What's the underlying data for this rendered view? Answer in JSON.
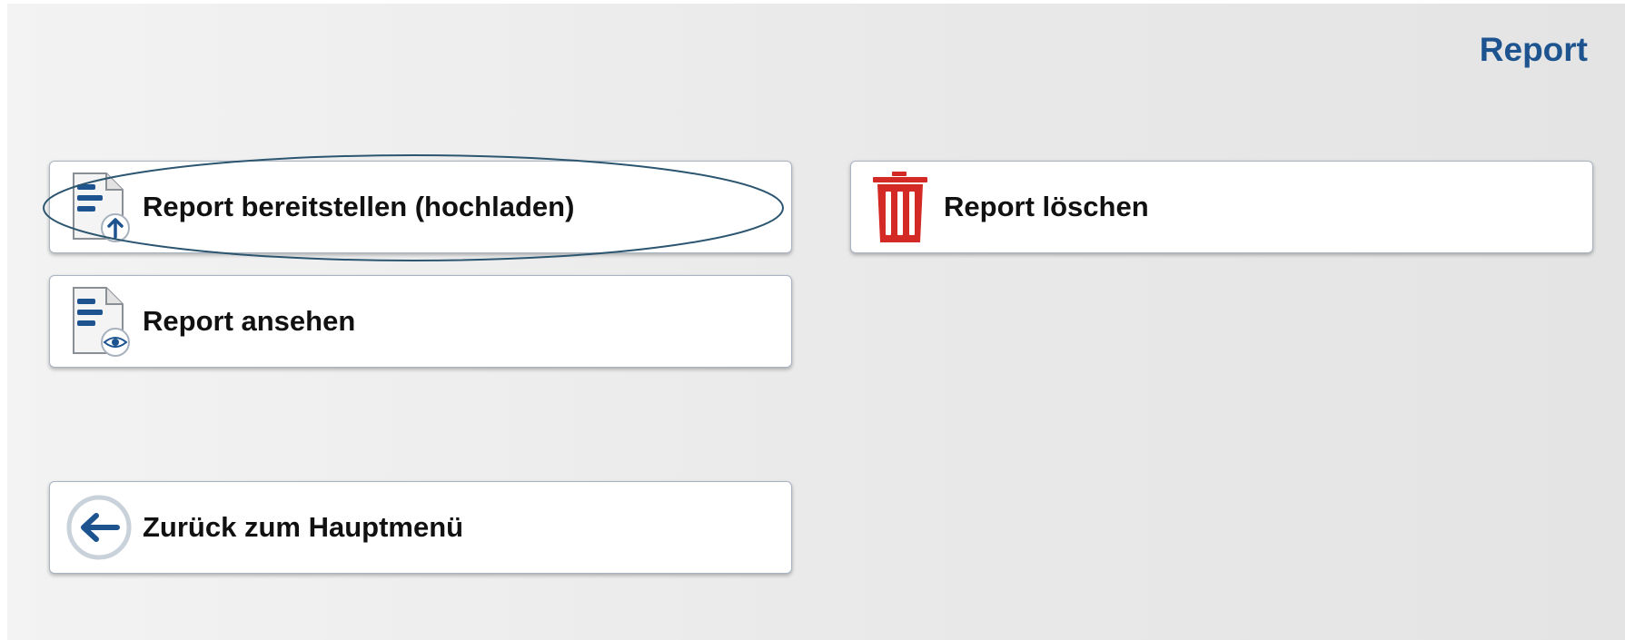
{
  "header": {
    "title": "Report"
  },
  "actions": {
    "upload_label": "Report bereitstellen (hochladen)",
    "view_label": "Report ansehen",
    "delete_label": "Report löschen",
    "back_label": "Zurück zum Hauptmenü"
  },
  "icons": {
    "upload": "document-upload-icon",
    "view": "document-view-icon",
    "delete": "trash-icon",
    "back": "arrow-left-icon"
  },
  "colors": {
    "title": "#1d5490",
    "icon_blue": "#1d5490",
    "delete_red": "#d32a25",
    "highlight_outline": "#2c5570"
  }
}
